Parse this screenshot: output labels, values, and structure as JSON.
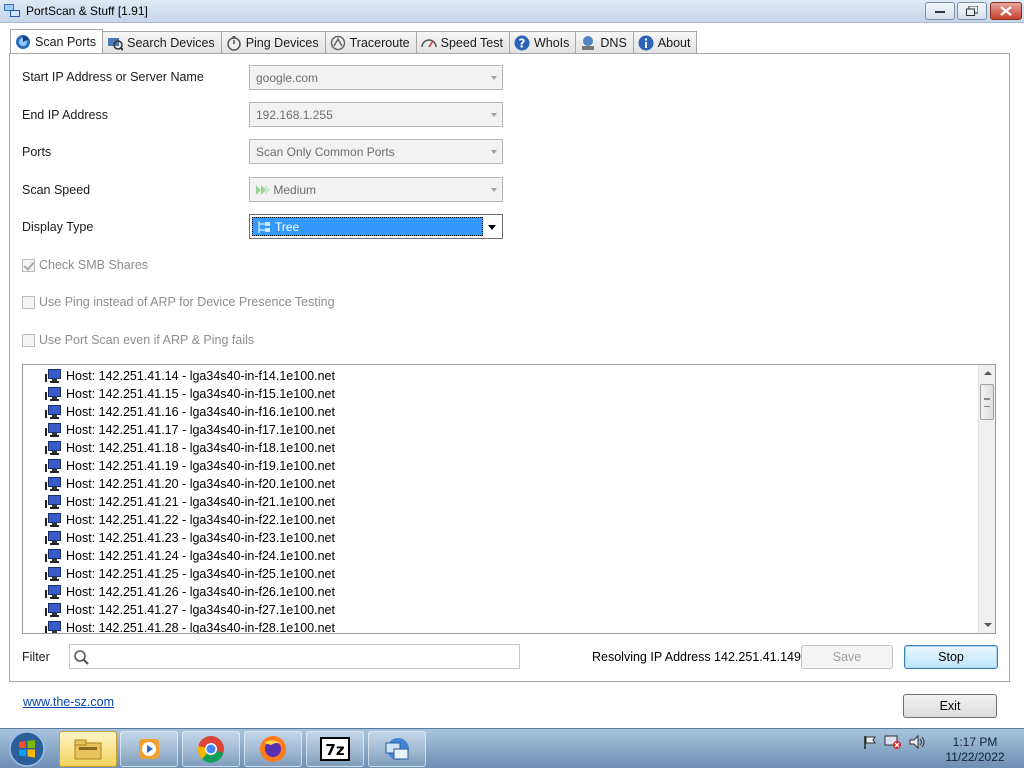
{
  "window": {
    "title": "PortScan & Stuff [1.91]"
  },
  "tabs": [
    {
      "label": "Scan Ports",
      "icon": "network-scan-icon",
      "active": true
    },
    {
      "label": "Search Devices",
      "icon": "search-devices-icon"
    },
    {
      "label": "Ping Devices",
      "icon": "stopwatch-icon"
    },
    {
      "label": "Traceroute",
      "icon": "traceroute-icon"
    },
    {
      "label": "Speed Test",
      "icon": "speedometer-icon"
    },
    {
      "label": "WhoIs",
      "icon": "question-icon"
    },
    {
      "label": "DNS",
      "icon": "dns-icon"
    },
    {
      "label": "About",
      "icon": "info-icon"
    }
  ],
  "form": {
    "start_ip_label": "Start IP Address or Server Name",
    "start_ip_value": "google.com",
    "end_ip_label": "End IP Address",
    "end_ip_value": "192.168.1.255",
    "ports_label": "Ports",
    "ports_value": "Scan Only Common Ports",
    "speed_label": "Scan Speed",
    "speed_value": "Medium",
    "display_label": "Display Type",
    "display_value": "Tree",
    "check_smb": {
      "label": "Check SMB Shares",
      "checked": true
    },
    "use_ping": {
      "label": "Use Ping instead of ARP for Device Presence Testing",
      "checked": false
    },
    "use_portscan": {
      "label": "Use Port Scan even if ARP & Ping fails",
      "checked": false
    }
  },
  "hosts": [
    "Host: 142.251.41.14 - lga34s40-in-f14.1e100.net",
    "Host: 142.251.41.15 - lga34s40-in-f15.1e100.net",
    "Host: 142.251.41.16 - lga34s40-in-f16.1e100.net",
    "Host: 142.251.41.17 - lga34s40-in-f17.1e100.net",
    "Host: 142.251.41.18 - lga34s40-in-f18.1e100.net",
    "Host: 142.251.41.19 - lga34s40-in-f19.1e100.net",
    "Host: 142.251.41.20 - lga34s40-in-f20.1e100.net",
    "Host: 142.251.41.21 - lga34s40-in-f21.1e100.net",
    "Host: 142.251.41.22 - lga34s40-in-f22.1e100.net",
    "Host: 142.251.41.23 - lga34s40-in-f23.1e100.net",
    "Host: 142.251.41.24 - lga34s40-in-f24.1e100.net",
    "Host: 142.251.41.25 - lga34s40-in-f25.1e100.net",
    "Host: 142.251.41.26 - lga34s40-in-f26.1e100.net",
    "Host: 142.251.41.27 - lga34s40-in-f27.1e100.net",
    "Host: 142.251.41.28 - lga34s40-in-f28.1e100.net"
  ],
  "bottom": {
    "filter_label": "Filter",
    "filter_value": "",
    "status_text": "Resolving IP Address 142.251.41.149...",
    "save_label": "Save",
    "stop_label": "Stop",
    "exit_label": "Exit",
    "website_link": "www.the-sz.com"
  },
  "taskbar": {
    "items": [
      "file-explorer-icon",
      "media-player-icon",
      "chrome-icon",
      "firefox-icon",
      "7zip-icon",
      "portscan-icon"
    ],
    "time": "1:17 PM",
    "date": "11/22/2022"
  },
  "colors": {
    "selection": "#3399ff",
    "link": "#0645ad",
    "close_button": "#c4412c"
  }
}
